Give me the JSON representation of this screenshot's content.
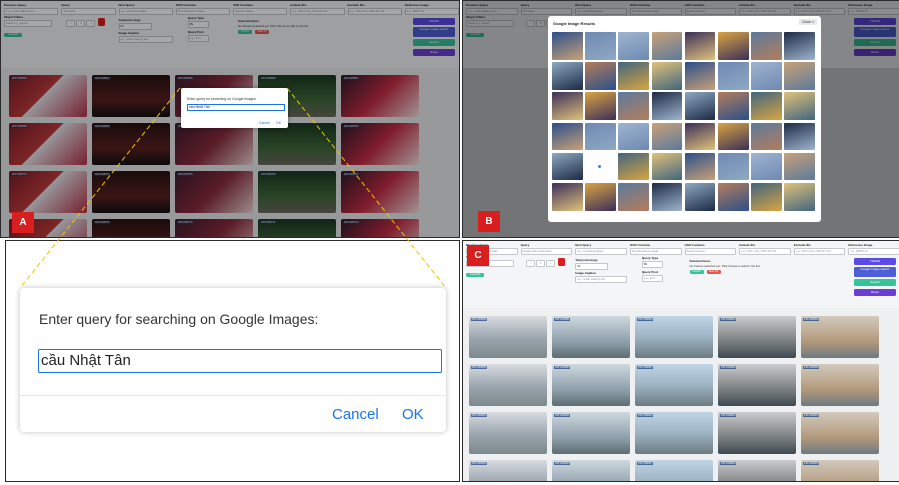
{
  "labels": {
    "a": "A",
    "b": "B",
    "c": "C"
  },
  "toolbar": {
    "fields": [
      "Previous Query",
      "Query",
      "Next Query",
      "OCR Contains",
      "ASR Contains",
      "Include IDs",
      "Exclude IDs",
      "Reference Image"
    ],
    "placeholders": [
      "e.g., a man walking and ...",
      "Text query",
      "e.g., something happe...",
      "Text detected in image...",
      "Speech content...",
      "e.g., 0:00.1,L01_V001:1F 2:31",
      "e.g., 0:00.1,L01_V001:1F 2:31",
      "e.g., 5528 2:12"
    ],
    "object_filters": "Object Filters",
    "select_objects": "Select e.g., person",
    "temporal_range": "Temporal range",
    "temporal_value": "60",
    "query_type": "Query Type",
    "query_type_value": "f8s",
    "image_caption": "Image Caption",
    "image_caption_placeholder": "e.g., ocean wearing and",
    "query_pool": "Query Pool",
    "query_pool_placeholder": "e.g., 2F 0",
    "selected_items": "Selected Items",
    "no_frames": "No frames selected yet. Pick frames to add to the list.",
    "add_btn": "Confirm",
    "clear_btn": "Clear (0)",
    "trake_btn": "TRAKE",
    "google_btn": "Google Image search",
    "search_btn": "Search",
    "reset_btn": "Reset",
    "stepper_minus": "−",
    "stepper_value": "0",
    "stepper_plus": "+",
    "load_more": "Load 200"
  },
  "panel_c": {
    "query_value": "bridge under construction",
    "placeholders": [
      "e.g., something and scale",
      "bridge under construction",
      "e.g., something happe...",
      "Text detected in image...",
      "Speech content...",
      "e.g., 0:00.1,L01_V001 1F 2:31",
      "e.g., 0:00.1,L01_V001 1F 2:31",
      "e.g., 5528 2:12"
    ]
  },
  "dialog": {
    "prompt": "Enter query for searching on Google Images:",
    "value": "cầu Nhật Tân",
    "cancel": "Cancel",
    "ok": "OK"
  },
  "small_dialog": {
    "prompt": "Enter query for searching on Google Images",
    "value": "cầu Nhật Tân",
    "cancel": "Cancel",
    "ok": "OK"
  },
  "google_results": {
    "title": "Google Image Results",
    "close": "Close ×"
  },
  "frame_ids_a": [
    "K01V005693",
    "K01V005694",
    "K01V005695",
    "K01V005696",
    "K01V005697",
    "K01V005698",
    "K01V005699",
    "K01V005700",
    "K01V005701",
    "K01V005702",
    "K01V005703",
    "K01V005704",
    "K01V005705",
    "K01V005706",
    "K01V005707",
    "K01V005708",
    "K01V005709",
    "K01V005710",
    "K01V005711",
    "K01V005712"
  ],
  "frame_ids_c": [
    "K21V009890",
    "K21V009891",
    "K21V009892",
    "K21V009893",
    "K21V009894",
    "K21V009895",
    "K21V009896",
    "K21V009897",
    "K21V009898",
    "K21V009899",
    "K21V009900",
    "K21V009901",
    "K21V009902",
    "K21V009903",
    "K21V009904",
    "K21V009905",
    "K21V009906",
    "K21V009907",
    "K21V009908",
    "K21V009909"
  ],
  "colors": {
    "trake": "#5b4be6",
    "google": "#4c5fd6",
    "search": "#35c49a",
    "reset": "#6b3fd6",
    "accent_red": "#d81e1e",
    "dialog_button": "#1a73e8",
    "leader_line": "#f2c200"
  }
}
